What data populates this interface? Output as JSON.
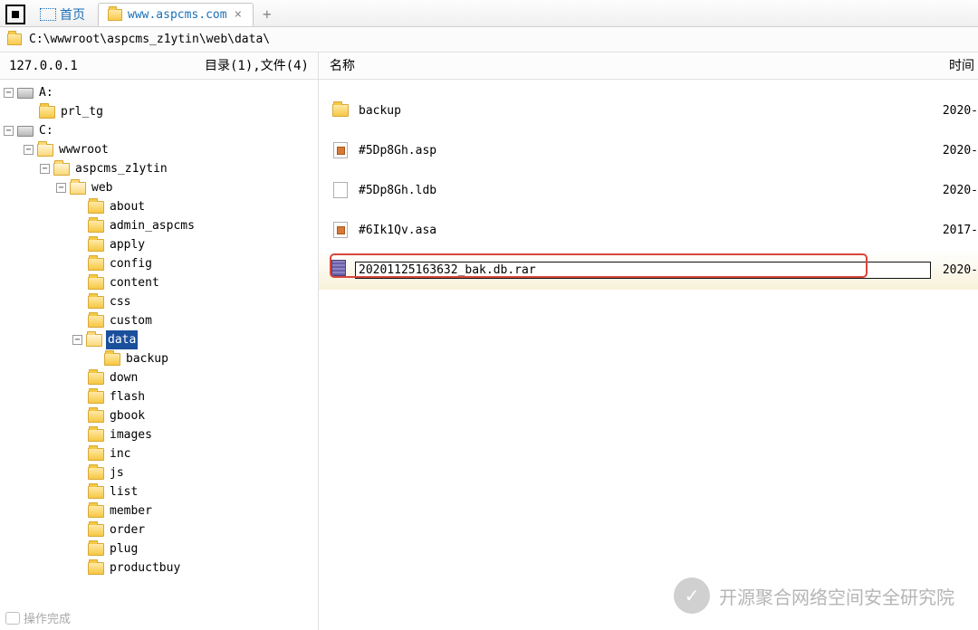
{
  "tabs": {
    "home_label": "首页",
    "url_label": "www.aspcms.com"
  },
  "path_bar": "C:\\wwwroot\\aspcms_z1ytin\\web\\data\\",
  "tree": {
    "host": "127.0.0.1",
    "summary": "目录(1),文件(4)",
    "driveA": "A:",
    "prl_tg": "prl_tg",
    "driveC": "C:",
    "wwwroot": "wwwroot",
    "aspcms": "aspcms_z1ytin",
    "web": "web",
    "folders": {
      "about": "about",
      "admin_aspcms": "admin_aspcms",
      "apply": "apply",
      "config": "config",
      "content": "content",
      "css": "css",
      "custom": "custom",
      "data": "data",
      "backup": "backup",
      "down": "down",
      "flash": "flash",
      "gbook": "gbook",
      "images": "images",
      "inc": "inc",
      "js": "js",
      "list": "list",
      "member": "member",
      "order": "order",
      "plug": "plug",
      "productbuy": "productbuy"
    }
  },
  "list": {
    "headers": {
      "name": "名称",
      "time": "时间"
    },
    "rows": [
      {
        "name": "backup",
        "time": "2020-",
        "type": "folder"
      },
      {
        "name": "#5Dp8Gh.asp",
        "time": "2020-",
        "type": "asp"
      },
      {
        "name": "#5Dp8Gh.ldb",
        "time": "2020-",
        "type": "ldb"
      },
      {
        "name": "#6Ik1Qv.asa",
        "time": "2017-",
        "type": "asa"
      }
    ],
    "rename": {
      "value": "20201125163632_bak.db.rar",
      "time": "2020-"
    }
  },
  "watermark": "开源聚合网络空间安全研究院",
  "status": "操作完成"
}
